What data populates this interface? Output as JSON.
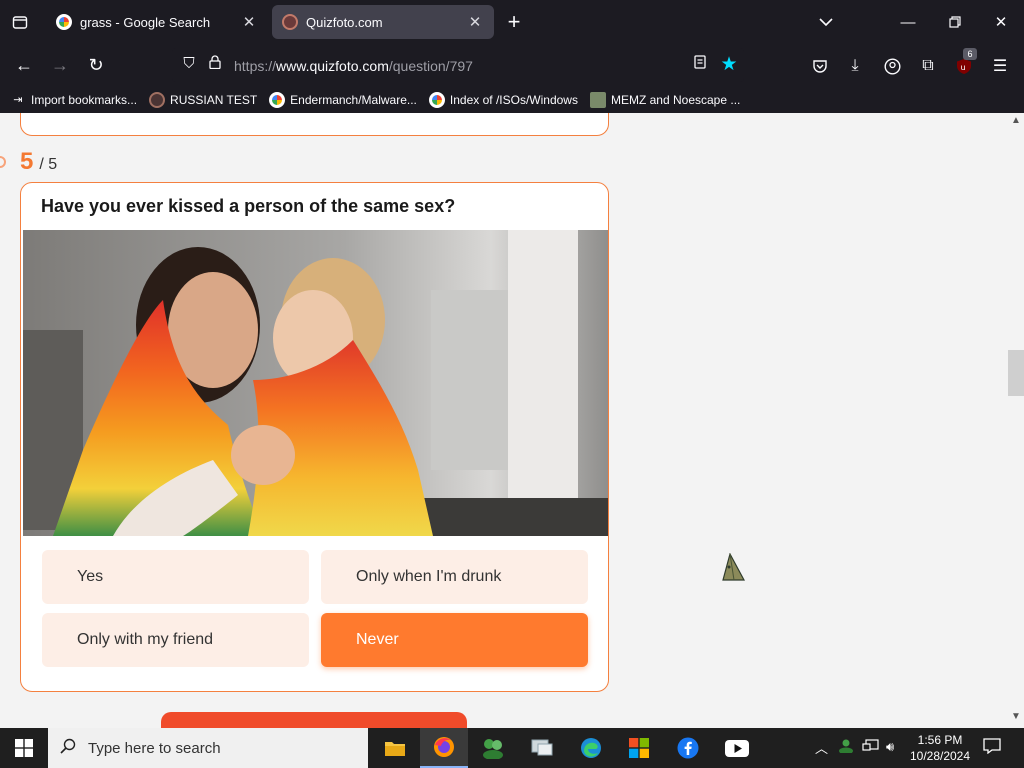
{
  "browser": {
    "tabs": [
      {
        "title": "grass - Google Search",
        "active": false
      },
      {
        "title": "Quizfoto.com",
        "active": true
      }
    ],
    "url": {
      "scheme": "https://",
      "host": "www.quizfoto.com",
      "path": "/question/797"
    },
    "extension_badge": "6",
    "bookmarks": [
      {
        "label": "Import bookmarks...",
        "icon": "import-icon"
      },
      {
        "label": "RUSSIAN TEST",
        "icon": "site-icon"
      },
      {
        "label": "Endermanch/Malware...",
        "icon": "google-icon"
      },
      {
        "label": "Index of /ISOs/Windows",
        "icon": "google-icon"
      },
      {
        "label": "MEMZ and Noescape ...",
        "icon": "image-icon"
      }
    ]
  },
  "quiz": {
    "counter_current": "5",
    "counter_total": "/ 5",
    "question": "Have you ever kissed a person of the same sex?",
    "answers": [
      {
        "label": "Yes",
        "selected": false
      },
      {
        "label": "Only when I'm drunk",
        "selected": false
      },
      {
        "label": "Only with my friend",
        "selected": false
      },
      {
        "label": "Never",
        "selected": true
      }
    ]
  },
  "taskbar": {
    "search_placeholder": "Type here to search",
    "time": "1:56 PM",
    "date": "10/28/2024"
  },
  "colors": {
    "accent": "#ff7a2e",
    "card_border": "#f4803f",
    "answer_bg": "#fdeee6",
    "browser_bg": "#1c1b22"
  }
}
